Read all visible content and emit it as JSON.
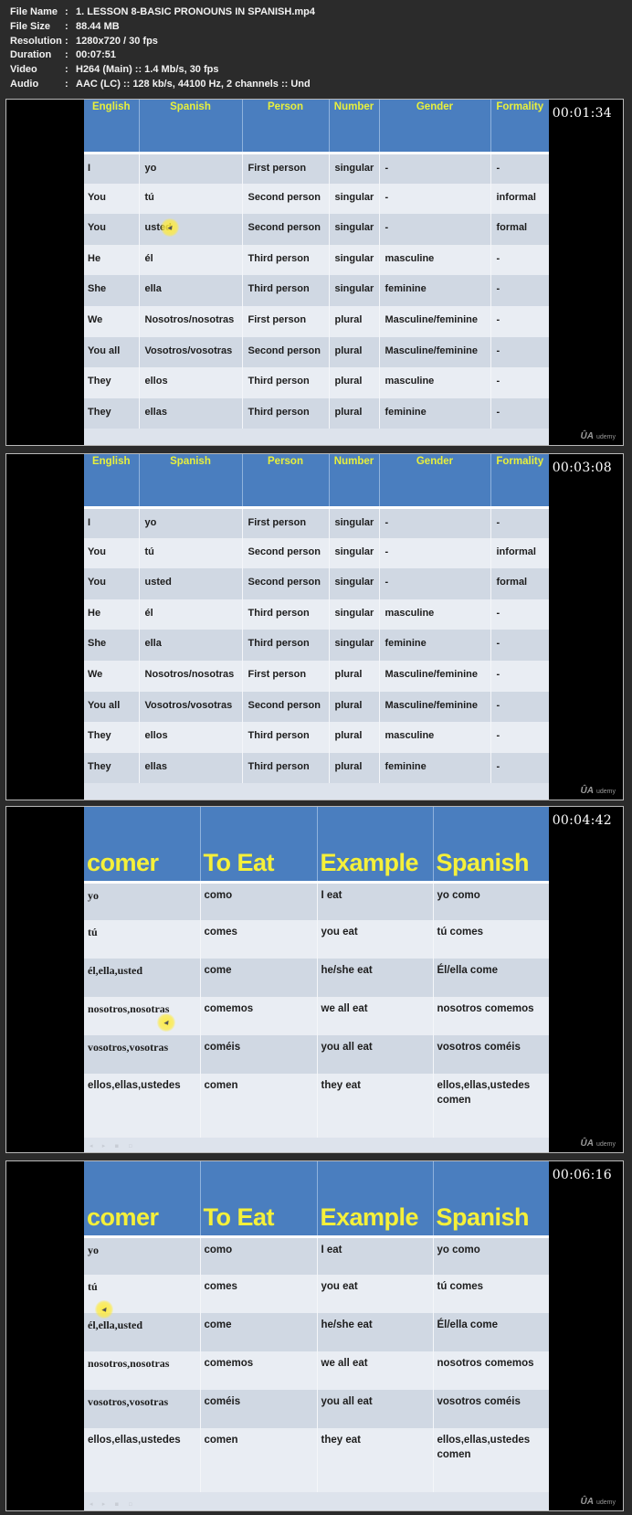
{
  "file_info": [
    {
      "key": "File Name",
      "value": "1. LESSON 8-BASIC PRONOUNS IN SPANISH.mp4"
    },
    {
      "key": "File Size",
      "value": "88.44 MB"
    },
    {
      "key": "Resolution",
      "value": "1280x720 / 30 fps"
    },
    {
      "key": "Duration",
      "value": "00:07:51"
    },
    {
      "key": "Video",
      "value": "H264 (Main) :: 1.4 Mb/s, 30 fps"
    },
    {
      "key": "Audio",
      "value": "AAC (LC) :: 128 kb/s, 44100 Hz, 2 channels :: Und"
    }
  ],
  "separator": ":",
  "watermark": "udemy",
  "watermark_glyph": "ÛA",
  "slide_controls": "◂ ▸ ▪ ▫",
  "colors": {
    "header_bg": "#4a7ebf",
    "header_text": "#e8f03c",
    "row_dark": "#d0d8e3",
    "row_light": "#e9edf3",
    "cursor_highlight": "#ffeb3c"
  },
  "pronoun_table": {
    "headers": [
      "English",
      "Spanish",
      "Person",
      "Number",
      "Gender",
      "Formality"
    ],
    "rows": [
      [
        "I",
        "yo",
        "First person",
        "singular",
        "-",
        "-"
      ],
      [
        "You",
        "tú",
        "Second person",
        "singular",
        "-",
        "informal"
      ],
      [
        "You",
        "usted",
        "Second person",
        "singular",
        "-",
        "formal"
      ],
      [
        "He",
        "él",
        "Third person",
        "singular",
        "masculine",
        "-"
      ],
      [
        "She",
        "ella",
        "Third person",
        "singular",
        "feminine",
        "-"
      ],
      [
        "We",
        "Nosotros/nosotras",
        "First person",
        "plural",
        "Masculine/feminine",
        "-"
      ],
      [
        "You all",
        "Vosotros/vosotras",
        "Second person",
        "plural",
        "Masculine/feminine",
        "-"
      ],
      [
        "They",
        "ellos",
        "Third person",
        "plural",
        "masculine",
        "-"
      ],
      [
        "They",
        "ellas",
        "Third person",
        "plural",
        "feminine",
        "-"
      ]
    ]
  },
  "comer_table": {
    "headers": [
      "comer",
      "To Eat",
      "Example",
      "Spanish"
    ],
    "rows": [
      [
        "yo",
        "como",
        "I eat",
        "yo como"
      ],
      [
        "tú",
        "comes",
        "you eat",
        "tú comes"
      ],
      [
        "él,ella,usted",
        "come",
        "he/she eat",
        "Él/ella come"
      ],
      [
        "nosotros,nosotras",
        "comemos",
        "we all eat",
        "nosotros comemos"
      ],
      [
        "vosotros,vosotras",
        "coméis",
        "you all eat",
        "vosotros coméis"
      ],
      [
        "ellos,ellas,ustedes",
        "comen",
        "they eat",
        "ellos,ellas,ustedes comen"
      ]
    ]
  },
  "frames": [
    {
      "timestamp": "00:01:34",
      "slide": "pronoun_table"
    },
    {
      "timestamp": "00:03:08",
      "slide": "pronoun_table"
    },
    {
      "timestamp": "00:04:42",
      "slide": "comer_table"
    },
    {
      "timestamp": "00:06:16",
      "slide": "comer_table"
    }
  ]
}
